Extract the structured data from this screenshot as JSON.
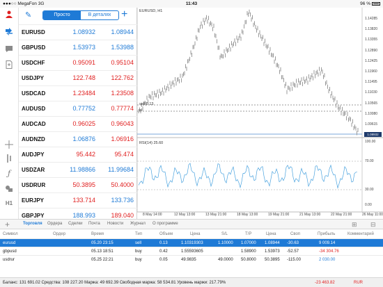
{
  "statusbar": {
    "carrier": "●●●○○ MegaFon  3G",
    "time": "11:43",
    "battery": "96 %"
  },
  "quotes": {
    "mode_simple": "Просто",
    "mode_detailed": "В деталях",
    "rows": [
      {
        "symbol": "EURUSD",
        "bid": "1.08932",
        "ask": "1.08944",
        "bid_color": "blue",
        "ask_color": "blue"
      },
      {
        "symbol": "GBPUSD",
        "bid": "1.53973",
        "ask": "1.53988",
        "bid_color": "blue",
        "ask_color": "blue"
      },
      {
        "symbol": "USDCHF",
        "bid": "0.95091",
        "ask": "0.95104",
        "bid_color": "red",
        "ask_color": "red"
      },
      {
        "symbol": "USDJPY",
        "bid": "122.748",
        "ask": "122.762",
        "bid_color": "red",
        "ask_color": "red"
      },
      {
        "symbol": "USDCAD",
        "bid": "1.23484",
        "ask": "1.23508",
        "bid_color": "red",
        "ask_color": "red"
      },
      {
        "symbol": "AUDUSD",
        "bid": "0.77752",
        "ask": "0.77774",
        "bid_color": "blue",
        "ask_color": "red"
      },
      {
        "symbol": "AUDCAD",
        "bid": "0.96025",
        "ask": "0.96043",
        "bid_color": "red",
        "ask_color": "red"
      },
      {
        "symbol": "AUDNZD",
        "bid": "1.06876",
        "ask": "1.06916",
        "bid_color": "blue",
        "ask_color": "red"
      },
      {
        "symbol": "AUDJPY",
        "bid": "95.442",
        "ask": "95.474",
        "bid_color": "red",
        "ask_color": "red"
      },
      {
        "symbol": "USDZAR",
        "bid": "11.98866",
        "ask": "11.99684",
        "bid_color": "blue",
        "ask_color": "blue"
      },
      {
        "symbol": "USDRUR",
        "bid": "50.3895",
        "ask": "50.4000",
        "bid_color": "red",
        "ask_color": "red"
      },
      {
        "symbol": "EURJPY",
        "bid": "133.714",
        "ask": "133.736",
        "bid_color": "red",
        "ask_color": "blue"
      },
      {
        "symbol": "GBPJPY",
        "bid": "188.993",
        "ask": "189.040",
        "bid_color": "blue",
        "ask_color": "red"
      }
    ]
  },
  "chart": {
    "symbol_label": "EURUSD, H1",
    "sell_label": "sell 0.13",
    "sl_label": "sl",
    "rsi_label": "RSI(14) 25.60",
    "price_ticks": [
      "1.14285",
      "1.13820",
      "1.13355",
      "1.12890",
      "1.12425",
      "1.11960",
      "1.11495",
      "1.11030",
      "1.10565",
      "1.10080",
      "1.09615",
      "1.08932"
    ],
    "rsi_ticks": [
      "100.00",
      "70.00",
      "30.00",
      "0.00"
    ],
    "time_ticks": [
      "8 May 14:00",
      "12 May 13:00",
      "13 May 21:00",
      "18 May 13:00",
      "19 May 21:00",
      "21 May 13:00",
      "22 May 21:00",
      "26 May 11:00"
    ],
    "current_price": "1.08932"
  },
  "tabs": [
    "Торговля",
    "Ордера",
    "Сделки",
    "Почта",
    "Новости",
    "Журнал",
    "О программе"
  ],
  "table": {
    "headers": [
      "Символ",
      "Ордер",
      "Время",
      "Тип",
      "Объем",
      "Цена",
      "S/L",
      "T/P",
      "Цена",
      "Своп",
      "Прибыль",
      "Комментарий"
    ],
    "rows": [
      {
        "symbol": "eurusd",
        "time": "05.20 23:15",
        "type": "sell",
        "volume": "0.13",
        "price": "1.10319303",
        "sl": "1.10000",
        "tp": "1.07000",
        "cur": "1.08944",
        "swap": "-30.63",
        "profit": "9 009.14",
        "profit_sign": "pos",
        "selected": true
      },
      {
        "symbol": "gbpusd",
        "time": "05.13 18:51",
        "type": "buy",
        "volume": "0.42",
        "price": "1.55593605",
        "sl": "",
        "tp": "1.58900",
        "cur": "1.53973",
        "swap": "-52.57",
        "profit": "-34 304.76",
        "profit_sign": "neg",
        "selected": false
      },
      {
        "symbol": "usdrur",
        "time": "05.25 22:21",
        "type": "buy",
        "volume": "0.05",
        "price": "49.9835",
        "sl": "49.0000",
        "tp": "50.8000",
        "cur": "50.3895",
        "swap": "-115.00",
        "profit": "2 030.00",
        "profit_sign": "pos",
        "selected": false
      }
    ]
  },
  "footer": {
    "summary": "Баланс: 131 691.02 Средства: 108 227.20 Маржа: 49 692.39 Свободная маржа: 58 534.81 Уровень маржи: 217.79%",
    "total": "-23 463.82",
    "currency": "RUR"
  }
}
